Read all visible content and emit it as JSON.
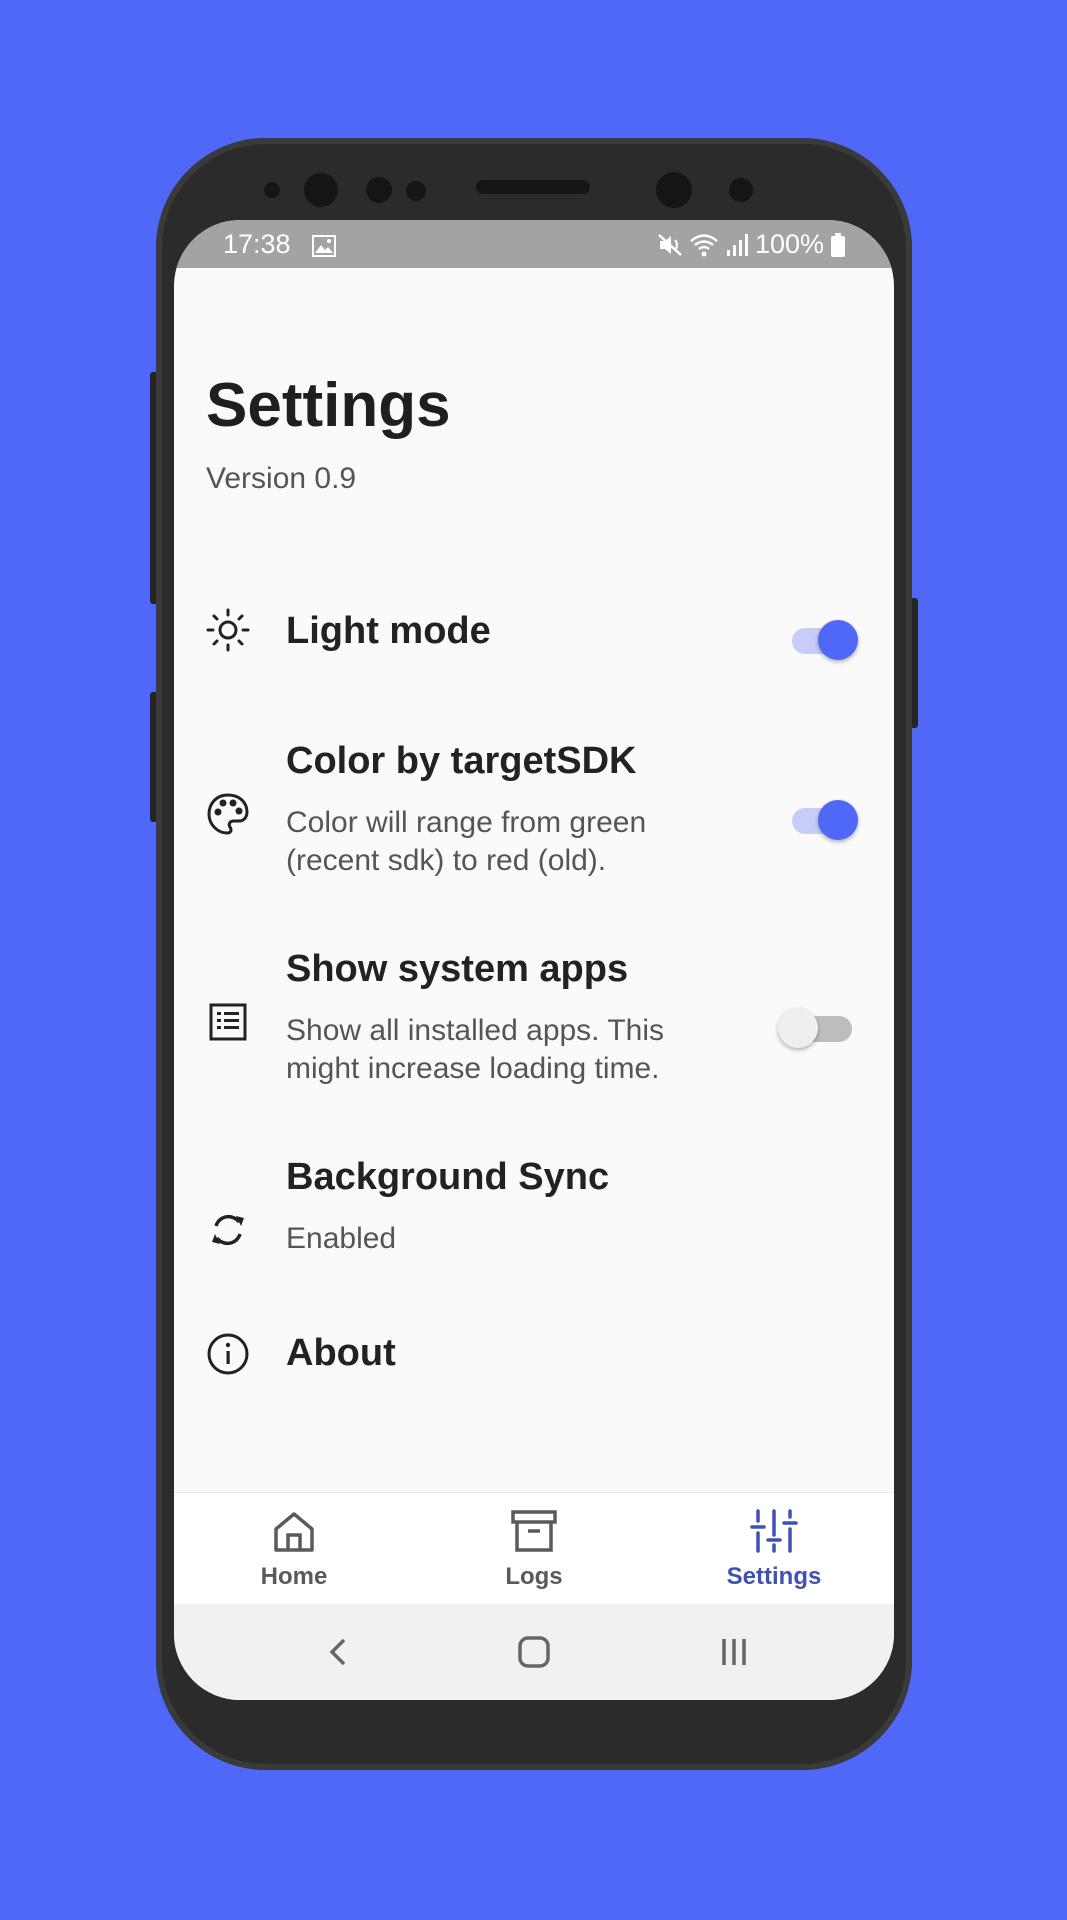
{
  "status_bar": {
    "time": "17:38",
    "battery": "100%"
  },
  "page": {
    "title": "Settings",
    "version": "Version 0.9"
  },
  "settings": [
    {
      "id": "light-mode",
      "icon": "sun-icon",
      "title": "Light mode",
      "description": "",
      "toggle": true
    },
    {
      "id": "color-by-target-sdk",
      "icon": "palette-icon",
      "title": "Color by targetSDK",
      "description": "Color will range from green (recent sdk) to red (old).",
      "toggle": true
    },
    {
      "id": "show-system-apps",
      "icon": "list-icon",
      "title": "Show system apps",
      "description": "Show all installed apps. This might increase loading time.",
      "toggle": false
    },
    {
      "id": "background-sync",
      "icon": "sync-icon",
      "title": "Background Sync",
      "description": "Enabled"
    },
    {
      "id": "about",
      "icon": "info-icon",
      "title": "About"
    }
  ],
  "bottom_nav": [
    {
      "label": "Home",
      "icon": "home-icon",
      "active": false
    },
    {
      "label": "Logs",
      "icon": "archive-icon",
      "active": false
    },
    {
      "label": "Settings",
      "icon": "sliders-icon",
      "active": true
    }
  ],
  "colors": {
    "accent": "#4f68f7",
    "active_nav": "#3f51b5",
    "background": "#4f68f7"
  }
}
